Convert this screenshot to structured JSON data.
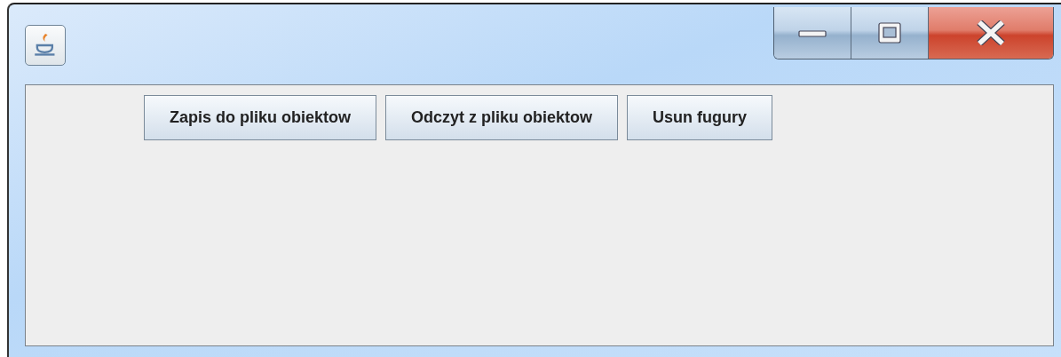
{
  "toolbar": {
    "buttons": [
      {
        "label": "Zapis do pliku obiektow"
      },
      {
        "label": "Odczyt z pliku obiektow"
      },
      {
        "label": "Usun fugury"
      }
    ]
  }
}
